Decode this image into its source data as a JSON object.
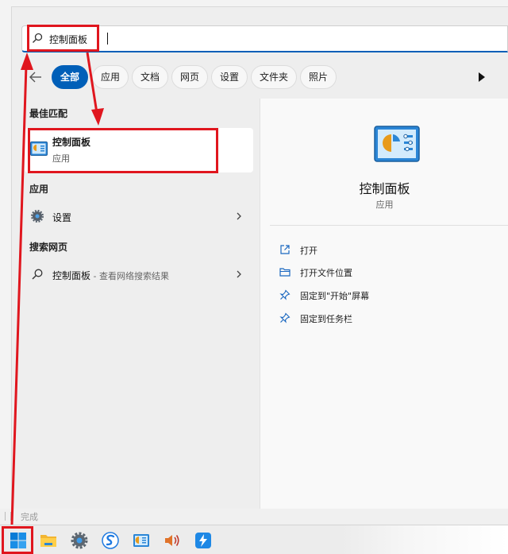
{
  "search": {
    "query": "控制面板"
  },
  "filters": {
    "back_icon": "arrow-left-icon",
    "chips": [
      "全部",
      "应用",
      "文档",
      "网页",
      "设置",
      "文件夹",
      "照片"
    ],
    "active_index": 0,
    "more_icon": "play-triangle-icon"
  },
  "best_match": {
    "section_title": "最佳匹配",
    "name": "控制面板",
    "type": "应用",
    "icon": "control-panel-icon"
  },
  "apps": {
    "section_title": "应用",
    "items": [
      {
        "label": "设置",
        "icon": "gear-icon"
      }
    ]
  },
  "web": {
    "section_title": "搜索网页",
    "items": [
      {
        "label": "控制面板",
        "sub": " - 查看网络搜索结果",
        "icon": "search-icon"
      }
    ]
  },
  "details": {
    "name": "控制面板",
    "type": "应用",
    "actions": [
      {
        "label": "打开",
        "icon": "open-external-icon"
      },
      {
        "label": "打开文件位置",
        "icon": "folder-icon"
      },
      {
        "label": "固定到\"开始\"屏幕",
        "icon": "pin-icon"
      },
      {
        "label": "固定到任务栏",
        "icon": "pin-icon"
      }
    ]
  },
  "status": {
    "text": "完成"
  },
  "taskbar": {
    "items": [
      "windows-start-icon",
      "file-explorer-icon",
      "settings-gear-icon",
      "sogou-browser-icon",
      "control-panel-icon",
      "volume-icon",
      "feishu-icon"
    ]
  },
  "colors": {
    "accent": "#005fb8",
    "annotation": "#e0161e"
  }
}
